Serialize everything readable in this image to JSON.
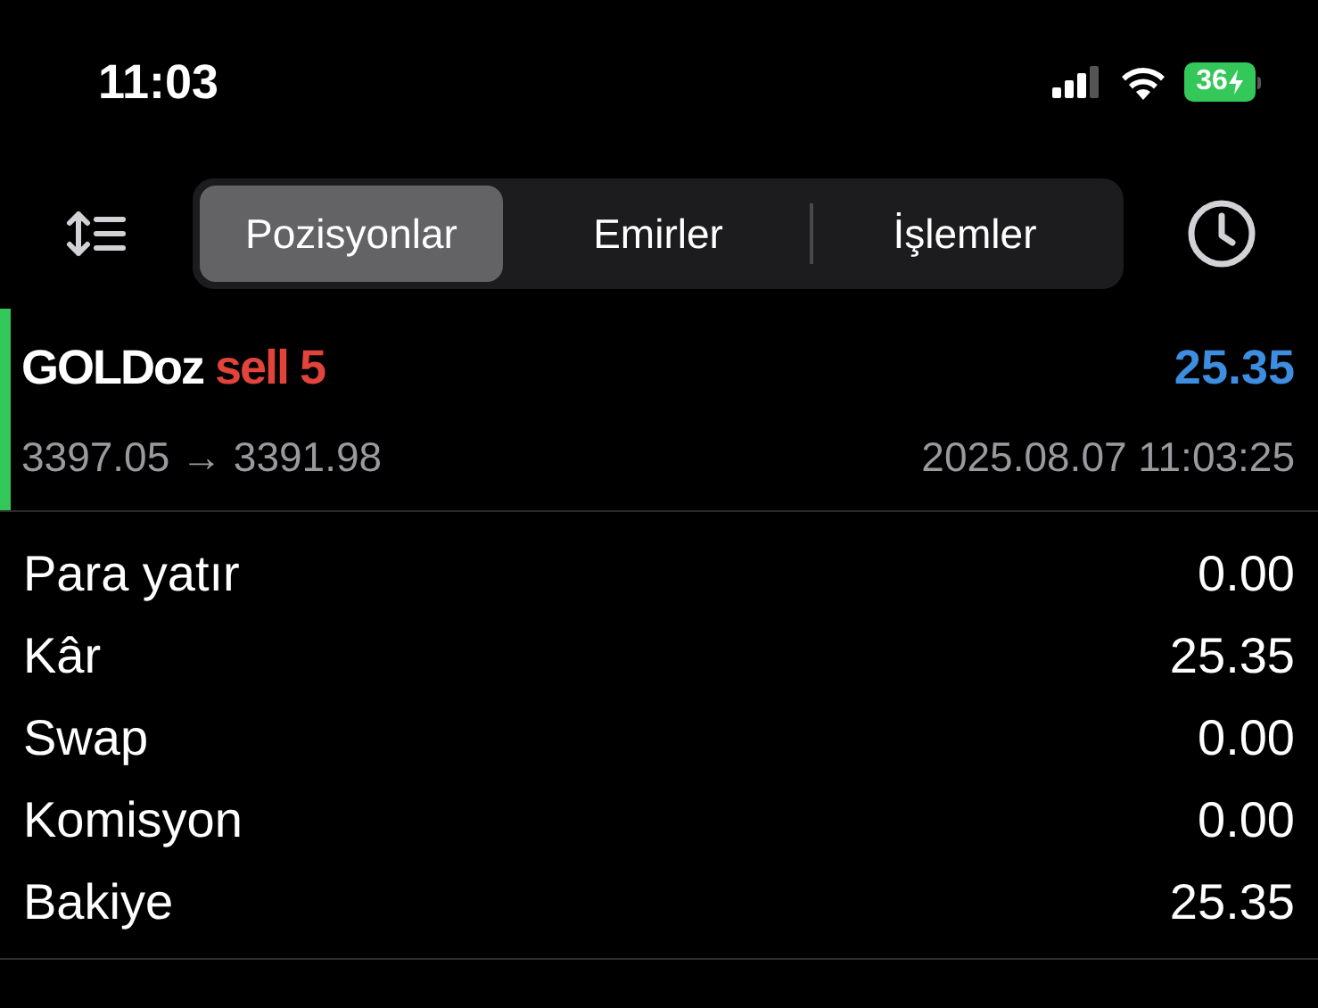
{
  "status_bar": {
    "time": "11:03",
    "battery": "36"
  },
  "tabs": [
    {
      "label": "Pozisyonlar",
      "selected": true
    },
    {
      "label": "Emirler",
      "selected": false
    },
    {
      "label": "İşlemler",
      "selected": false
    }
  ],
  "position": {
    "symbol": "GOLDoz",
    "side": "sell 5",
    "profit": "25.35",
    "prices": "3397.05 → 3391.98",
    "time": "2025.08.07 11:03:25"
  },
  "summary": [
    {
      "label": "Para yatır",
      "value": "0.00"
    },
    {
      "label": "Kâr",
      "value": "25.35"
    },
    {
      "label": "Swap",
      "value": "0.00"
    },
    {
      "label": "Komisyon",
      "value": "0.00"
    },
    {
      "label": "Bakiye",
      "value": "25.35"
    }
  ]
}
